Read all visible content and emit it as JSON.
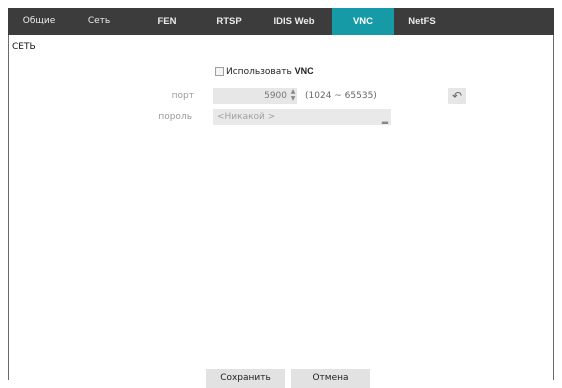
{
  "tabs": [
    {
      "label": "Общие"
    },
    {
      "label": "Сеть"
    },
    {
      "label": "FEN"
    },
    {
      "label": "RTSP"
    },
    {
      "label": "IDIS Web"
    },
    {
      "label": "VNC"
    },
    {
      "label": "NetFS"
    }
  ],
  "active_tab": "VNC",
  "section": {
    "title": "СЕТЬ"
  },
  "use_vnc": {
    "label_prefix": "Использовать ",
    "label_bold": "VNC",
    "checked": false
  },
  "port": {
    "label": "порт",
    "value": "5900",
    "range": "(1024 ~ 65535)"
  },
  "password": {
    "label": "пороль",
    "value": "<Никакой >"
  },
  "icons": {
    "undo": "undo-arrow-icon",
    "spin_up": "spin-up-icon",
    "spin_down": "spin-down-icon",
    "dropdown": "dropdown-caret-icon"
  },
  "footer": {
    "save_label": "Сохранить",
    "cancel_label": "Отмена"
  },
  "colors": {
    "tabbar": "#3c3c3c",
    "active_tab": "#169ba6"
  }
}
